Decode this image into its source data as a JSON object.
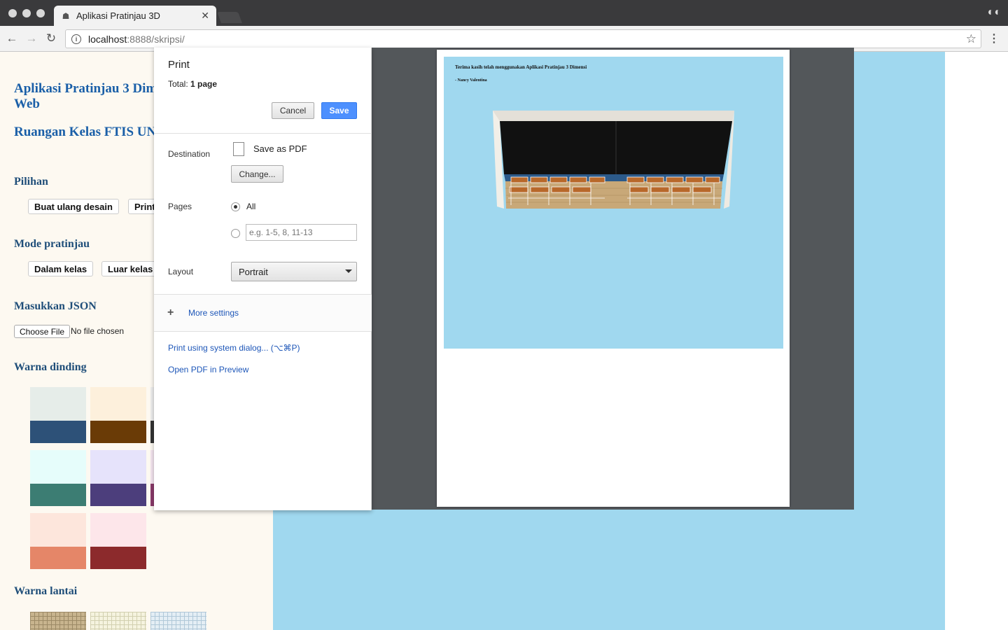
{
  "browser": {
    "tab_title": "Aplikasi Pratinjau 3D",
    "url_host": "localhost",
    "url_rest": ":8888/skripsi/"
  },
  "page": {
    "title": "Aplikasi Pratinjau 3 Dim",
    "title_line2": "Web",
    "subtitle": "Ruangan Kelas FTIS UN",
    "sections": {
      "pilihan": "Pilihan",
      "mode": "Mode pratinjau",
      "json": "Masukkan JSON",
      "warna_dinding": "Warna dinding",
      "warna_lantai": "Warna lantai"
    },
    "buttons": {
      "buat_ulang": "Buat ulang desain",
      "print": "Print",
      "dalam_kelas": "Dalam kelas",
      "luar_kelas": "Luar kelas"
    },
    "file": {
      "button": "Choose File",
      "status": "No file chosen"
    },
    "wall_colors": [
      {
        "top": "#e6ede9",
        "bottom": "#2d5178"
      },
      {
        "top": "#fdf0dc",
        "bottom": "#6a3b06"
      },
      {
        "top": "#e6fdfb",
        "bottom": "#3c7d73"
      },
      {
        "top": "#e6e3fb",
        "bottom": "#4c3e7c"
      },
      {
        "top": "#fde6dc",
        "bottom": "#e58668"
      },
      {
        "top": "#fde6ea",
        "bottom": "#8c2a2c"
      }
    ]
  },
  "print_dialog": {
    "title": "Print",
    "total_label": "Total:",
    "total_value": "1 page",
    "cancel": "Cancel",
    "save": "Save",
    "destination_label": "Destination",
    "destination_value": "Save as PDF",
    "change": "Change...",
    "pages_label": "Pages",
    "pages_all": "All",
    "pages_placeholder": "e.g. 1-5, 8, 11-13",
    "layout_label": "Layout",
    "layout_value": "Portrait",
    "more_settings": "More settings",
    "system_dialog": "Print using system dialog... (⌥⌘P)",
    "open_pdf": "Open PDF in Preview"
  },
  "preview": {
    "title": "Terima kasih telah menggunakan Aplikasi Pratinjau 3 Dimensi",
    "author": "- Nancy Valentina"
  }
}
